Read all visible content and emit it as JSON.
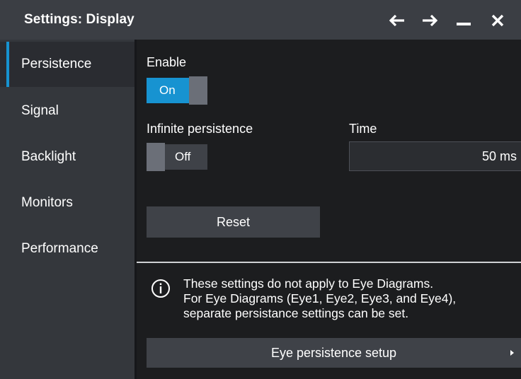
{
  "window": {
    "title": "Settings: Display",
    "controls": {
      "back": "arrow-left-icon",
      "forward": "arrow-right-icon",
      "minimize": "minimize-icon",
      "close": "close-icon"
    }
  },
  "sidebar": {
    "items": [
      {
        "label": "Persistence",
        "active": true
      },
      {
        "label": "Signal",
        "active": false
      },
      {
        "label": "Backlight",
        "active": false
      },
      {
        "label": "Monitors",
        "active": false
      },
      {
        "label": "Performance",
        "active": false
      }
    ]
  },
  "persistence": {
    "enable_label": "Enable",
    "enable_state": "On",
    "infinite_label": "Infinite persistence",
    "infinite_state": "Off",
    "time_label": "Time",
    "time_value": "50 ms",
    "reset_label": "Reset"
  },
  "info": {
    "icon": "info-circle-icon",
    "lines": [
      "These settings do not apply to Eye Diagrams.",
      "For Eye Diagrams (Eye1, Eye2, Eye3, and Eye4),",
      "separate persistance settings can be set."
    ],
    "button_label": "Eye persistence setup"
  },
  "colors": {
    "accent": "#1793d1",
    "titlebar": "#3b3e44",
    "sidebar": "#34373c",
    "background": "#1c1d1f",
    "button": "#3f4248"
  }
}
